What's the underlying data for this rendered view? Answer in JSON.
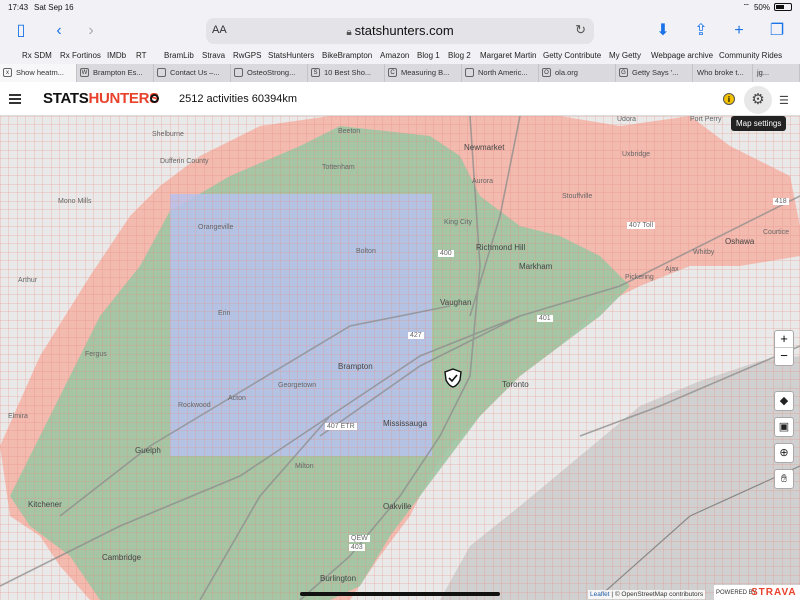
{
  "status_bar": {
    "time": "17:43",
    "date": "Sat Sep 16",
    "battery": "50%"
  },
  "browser": {
    "text_size_label": "AA",
    "url": "statshunters.com",
    "icons": [
      "sidebar-icon",
      "back-icon",
      "forward-icon",
      "lock-icon",
      "reload-icon",
      "download-icon",
      "share-icon",
      "new-tab-icon",
      "tabs-icon"
    ]
  },
  "bookmarks": [
    "Rx SDM",
    "Rx Fortinos",
    "IMDb",
    "RT",
    "BramLib",
    "Strava",
    "RwGPS",
    "StatsHunters",
    "BikeBrampton",
    "Amazon",
    "Blog 1",
    "Blog 2",
    "Margaret Martin",
    "Getty Contribute",
    "My Getty",
    "Webpage archive",
    "Community Rides"
  ],
  "tabs": [
    {
      "label": "Show heatm...",
      "icon": "x"
    },
    {
      "label": "Brampton Es...",
      "icon": "W"
    },
    {
      "label": "Contact Us –...",
      "icon": ""
    },
    {
      "label": "OsteoStrong...",
      "icon": ""
    },
    {
      "label": "10 Best Sho...",
      "icon": "S"
    },
    {
      "label": "Measuring B...",
      "icon": "C"
    },
    {
      "label": "North Americ...",
      "icon": ""
    },
    {
      "label": "ola.org",
      "icon": "O"
    },
    {
      "label": "Getty Says '...",
      "icon": "G"
    },
    {
      "label": "Who broke t...",
      "icon": ""
    },
    {
      "label": "jg...",
      "icon": ""
    }
  ],
  "app": {
    "logo_stats": "STATS",
    "logo_hunters": "HUNTERS",
    "activities_text": "2512 activities 60394km",
    "settings_tooltip": "Map settings"
  },
  "map": {
    "colors": {
      "red": "#e8412c",
      "green": "#9cc7a4",
      "blue": "#b6c2ee",
      "grid": "#e98b7b"
    },
    "places": [
      "Beeton",
      "Newmarket",
      "Udora",
      "Port Perry",
      "Shelburne",
      "Tottenham",
      "Aurora",
      "Uxbridge",
      "Mono Mills",
      "Dufferin County",
      "Stouffville",
      "Orangeville",
      "King City",
      "Bolton",
      "Richmond Hill",
      "Markham",
      "Oshawa",
      "Whitby",
      "Ajax",
      "Pickering",
      "Courtice",
      "Arthur",
      "Vaughan",
      "Erin",
      "Brampton",
      "Toronto",
      "Mississauga",
      "Georgetown",
      "Acton",
      "Rockwood",
      "Fergus",
      "Elmira",
      "Guelph",
      "Milton",
      "Kitchener",
      "Oakville",
      "Cambridge",
      "Burlington",
      "407 Toll",
      "407 ETR",
      "QEW",
      "403",
      "401",
      "418",
      "400",
      "427"
    ],
    "attribution_leaflet": "Leaflet",
    "attribution_text": "| © OpenStreetMap contributors",
    "powered_by": "POWERED BY",
    "strava": "STRAVA"
  },
  "controls": {
    "zoom_in": "+",
    "zoom_out": "−"
  }
}
